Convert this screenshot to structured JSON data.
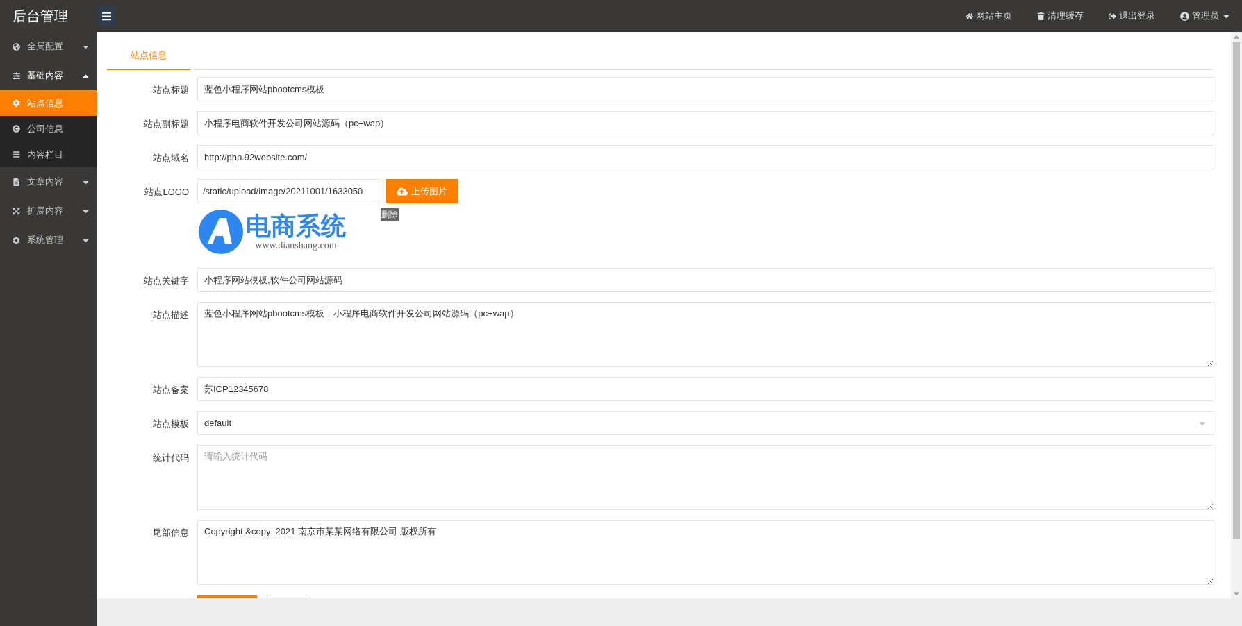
{
  "header": {
    "title": "后台管理",
    "links": [
      {
        "label": "网站主页"
      },
      {
        "label": "清理缓存"
      },
      {
        "label": "退出登录"
      }
    ],
    "user": {
      "label": "管理员"
    }
  },
  "sidebar": {
    "items": [
      {
        "label": "全局配置",
        "expanded": false
      },
      {
        "label": "基础内容",
        "expanded": true,
        "children": [
          {
            "label": "站点信息",
            "selected": true
          },
          {
            "label": "公司信息",
            "selected": false
          },
          {
            "label": "内容栏目",
            "selected": false
          }
        ]
      },
      {
        "label": "文章内容",
        "expanded": false
      },
      {
        "label": "扩展内容",
        "expanded": false
      },
      {
        "label": "系统管理",
        "expanded": false
      }
    ]
  },
  "tabs": [
    {
      "label": "站点信息",
      "selected": true
    }
  ],
  "form": {
    "fields": [
      {
        "kind": "text",
        "label": "站点标题",
        "value": "蓝色小程序网站pbootcms模板"
      },
      {
        "kind": "text",
        "label": "站点副标题",
        "value": "小程序电商软件开发公司网站源码（pc+wap）"
      },
      {
        "kind": "text",
        "label": "站点域名",
        "value": "http://php.92website.com/"
      },
      {
        "kind": "upload",
        "label": "站点LOGO",
        "value": "/static/upload/image/20211001/1633050",
        "button": "上传图片",
        "delete": "删除",
        "logo": {
          "title": "电商系统",
          "url": "www.dianshang.com"
        }
      },
      {
        "kind": "text",
        "label": "站点关键字",
        "value": "小程序网站模板,软件公司网站源码"
      },
      {
        "kind": "textarea",
        "label": "站点描述",
        "value": "蓝色小程序网站pbootcms模板，小程序电商软件开发公司网站源码（pc+wap）"
      },
      {
        "kind": "text",
        "label": "站点备案",
        "value": "苏ICP12345678"
      },
      {
        "kind": "select",
        "label": "站点模板",
        "value": "default"
      },
      {
        "kind": "textarea",
        "label": "统计代码",
        "placeholder": "请输入统计代码"
      },
      {
        "kind": "textarea",
        "label": "尾部信息",
        "value": "Copyright &copy; 2021 南京市某某网络有限公司 版权所有"
      }
    ],
    "actions": [
      {
        "kind": "primary"
      },
      {
        "kind": "default"
      }
    ]
  }
}
